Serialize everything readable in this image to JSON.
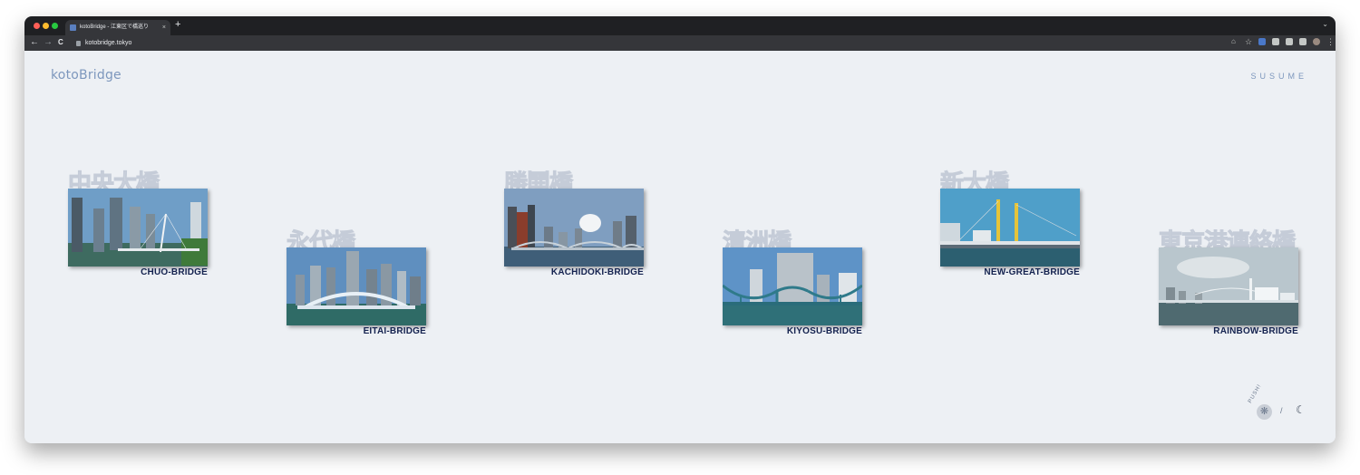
{
  "browser": {
    "tab_title": "kotoBridge - 江東区で橋巡り",
    "tab_close": "×",
    "new_tab": "+",
    "url": "kotobridge.tokyo",
    "back": "←",
    "forward": "→",
    "reload": "C",
    "star": "☆",
    "share": "⌂",
    "menu": "⋮",
    "expand": "⌄"
  },
  "site": {
    "logo": "kotoBridge",
    "nav_label": "SUSUME"
  },
  "bridges": [
    {
      "kanji": "中央大橋",
      "label": "CHUO-BRIDGE"
    },
    {
      "kanji": "永代橋",
      "label": "EITAI-BRIDGE"
    },
    {
      "kanji": "勝鬨橋",
      "label": "KACHIDOKI-BRIDGE"
    },
    {
      "kanji": "清洲橋",
      "label": "KIYOSU-BRIDGE"
    },
    {
      "kanji": "新大橋",
      "label": "NEW-GREAT-BRIDGE"
    },
    {
      "kanji": "東京港連絡橋",
      "label": "RAINBOW-BRIDGE"
    }
  ],
  "footer": {
    "push_label": "PUSH!",
    "gear_icon": "gear-icon",
    "gear_glyph": "❋",
    "separator": "/",
    "moon_icon": "moon-icon",
    "moon_glyph": "☾"
  },
  "colors": {
    "page_bg": "#edf0f4",
    "accent": "#7d97bd",
    "label": "#14224f"
  }
}
